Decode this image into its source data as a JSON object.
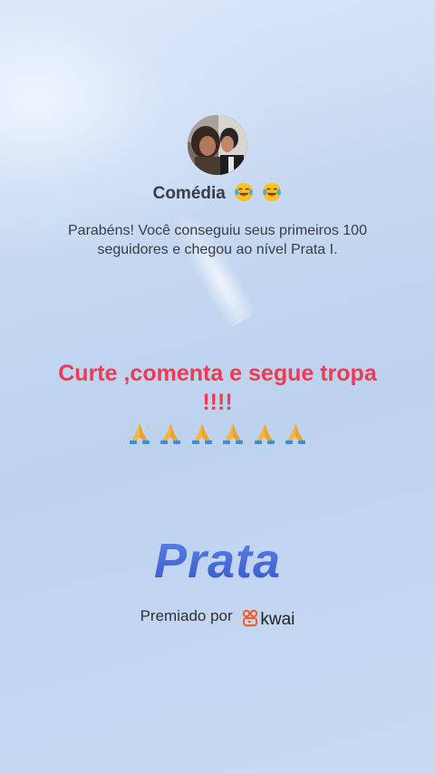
{
  "profile": {
    "name": "Comédia",
    "name_emoji_icon": "laughing-tears-emoji"
  },
  "achievement": {
    "description": "Parabéns! Você conseguiu seus primeiros 100 seguidores e chegou ao nível Prata I."
  },
  "post": {
    "caption": "Curte ,comenta e segue tropa !!!!",
    "emoji_icon": "praying-hands-emoji",
    "emoji_count": 6,
    "caption_color": "#ee3b55"
  },
  "level": {
    "title": "Prata",
    "title_color": "#4a6ad8"
  },
  "award": {
    "label": "Premiado por",
    "brand": "kwai",
    "brand_icon": "kwai-logo-icon",
    "brand_color": "#ff5a1f"
  },
  "colors": {
    "background": "#c4d6f1",
    "text": "#3a3d45"
  }
}
